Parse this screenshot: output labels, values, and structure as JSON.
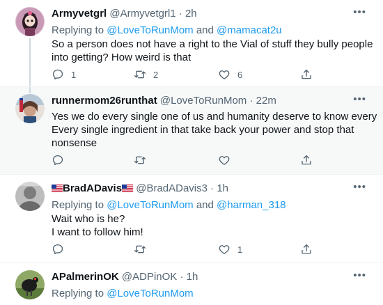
{
  "tweets": [
    {
      "name": "Armyvetgrl",
      "handle": "@Armyvetgrl1",
      "separator": "·",
      "time": "2h",
      "reply_prefix": "Replying to ",
      "reply_users": [
        "@LoveToRunMom",
        "@mamacat2u"
      ],
      "reply_joiner": " and ",
      "text_lines": [
        "So a person does not have a right to the Vial of stuff they bully people",
        "into getting? How weird is that"
      ],
      "replies": "1",
      "retweets": "2",
      "likes": "6"
    },
    {
      "name": "runnermom26runthat",
      "handle": "@LoveToRunMom",
      "separator": "·",
      "time": "22m",
      "text_lines": [
        "Yes we do every single one of us and humanity deserve to know every",
        "Every single ingredient in that take back your power and stop that",
        "nonsense"
      ],
      "replies": "",
      "retweets": "",
      "likes": ""
    },
    {
      "name": "BradADavis",
      "handle": "@BradADavis3",
      "separator": "·",
      "time": "1h",
      "reply_prefix": "Replying to ",
      "reply_users": [
        "@LoveToRunMom",
        "@harman_318"
      ],
      "reply_joiner": " and ",
      "text_lines": [
        "Wait who is he?",
        "I want to follow him!"
      ],
      "replies": "",
      "retweets": "",
      "likes": "1"
    },
    {
      "name": "APalmerinOK",
      "handle": "@ADPinOK",
      "separator": "·",
      "time": "1h",
      "reply_prefix": "Replying to ",
      "reply_users": [
        "@LoveToRunMom"
      ]
    }
  ],
  "icons": {
    "more": "more-options-icon",
    "reply": "reply-icon",
    "retweet": "retweet-icon",
    "like": "like-icon",
    "share": "share-icon",
    "flag": "us-flag-icon"
  },
  "more_glyph": "•••",
  "colors": {
    "link": "#1d9bf0",
    "secondary_text": "#536471",
    "highlight_bg": "#f7f9f9",
    "divider": "#eff3f4",
    "thread_line": "#cfd9de"
  }
}
